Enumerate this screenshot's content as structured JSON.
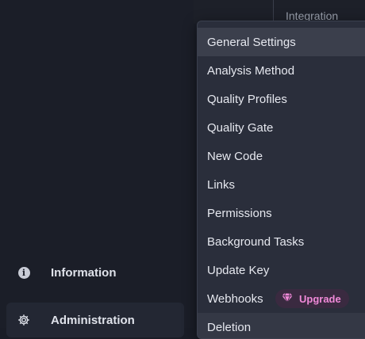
{
  "sidebar": {
    "items": [
      {
        "label": "Information",
        "icon": "info-icon"
      },
      {
        "label": "Administration",
        "icon": "gear-icon"
      }
    ]
  },
  "background_peek": "Integration",
  "menu": {
    "items": [
      {
        "label": "General Settings"
      },
      {
        "label": "Analysis Method"
      },
      {
        "label": "Quality Profiles"
      },
      {
        "label": "Quality Gate"
      },
      {
        "label": "New Code"
      },
      {
        "label": "Links"
      },
      {
        "label": "Permissions"
      },
      {
        "label": "Background Tasks"
      },
      {
        "label": "Update Key"
      },
      {
        "label": "Webhooks",
        "badge": "Upgrade",
        "badge_icon": "gem-icon"
      },
      {
        "label": "Deletion"
      }
    ]
  },
  "colors": {
    "background": "#1a1d27",
    "menu_background": "#2a2e3b",
    "menu_active": "#3b3f4c",
    "badge_text": "#f089d8",
    "badge_background": "#3a2a40"
  }
}
